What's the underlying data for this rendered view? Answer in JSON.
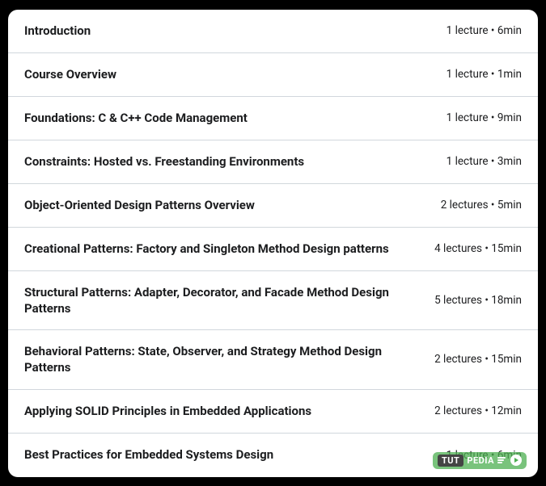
{
  "sections": [
    {
      "title": "Introduction",
      "meta": "1 lecture • 6min"
    },
    {
      "title": "Course Overview",
      "meta": "1 lecture • 1min"
    },
    {
      "title": "Foundations: C & C++ Code Management",
      "meta": "1 lecture • 9min"
    },
    {
      "title": "Constraints: Hosted vs. Freestanding Environments",
      "meta": "1 lecture • 3min"
    },
    {
      "title": "Object-Oriented Design Patterns Overview",
      "meta": "2 lectures • 5min"
    },
    {
      "title": "Creational Patterns: Factory and Singleton Method Design patterns",
      "meta": "4 lectures • 15min"
    },
    {
      "title": "Structural Patterns: Adapter, Decorator, and Facade Method Design Patterns",
      "meta": "5 lectures • 18min"
    },
    {
      "title": "Behavioral Patterns: State, Observer, and Strategy Method Design Patterns",
      "meta": "2 lectures • 15min"
    },
    {
      "title": "Applying SOLID Principles in Embedded Applications",
      "meta": "2 lectures • 12min"
    },
    {
      "title": "Best Practices for Embedded Systems Design",
      "meta": "1 lecture • 6min"
    }
  ],
  "watermark": {
    "part1": "TUT",
    "part2": "PEDIA"
  }
}
